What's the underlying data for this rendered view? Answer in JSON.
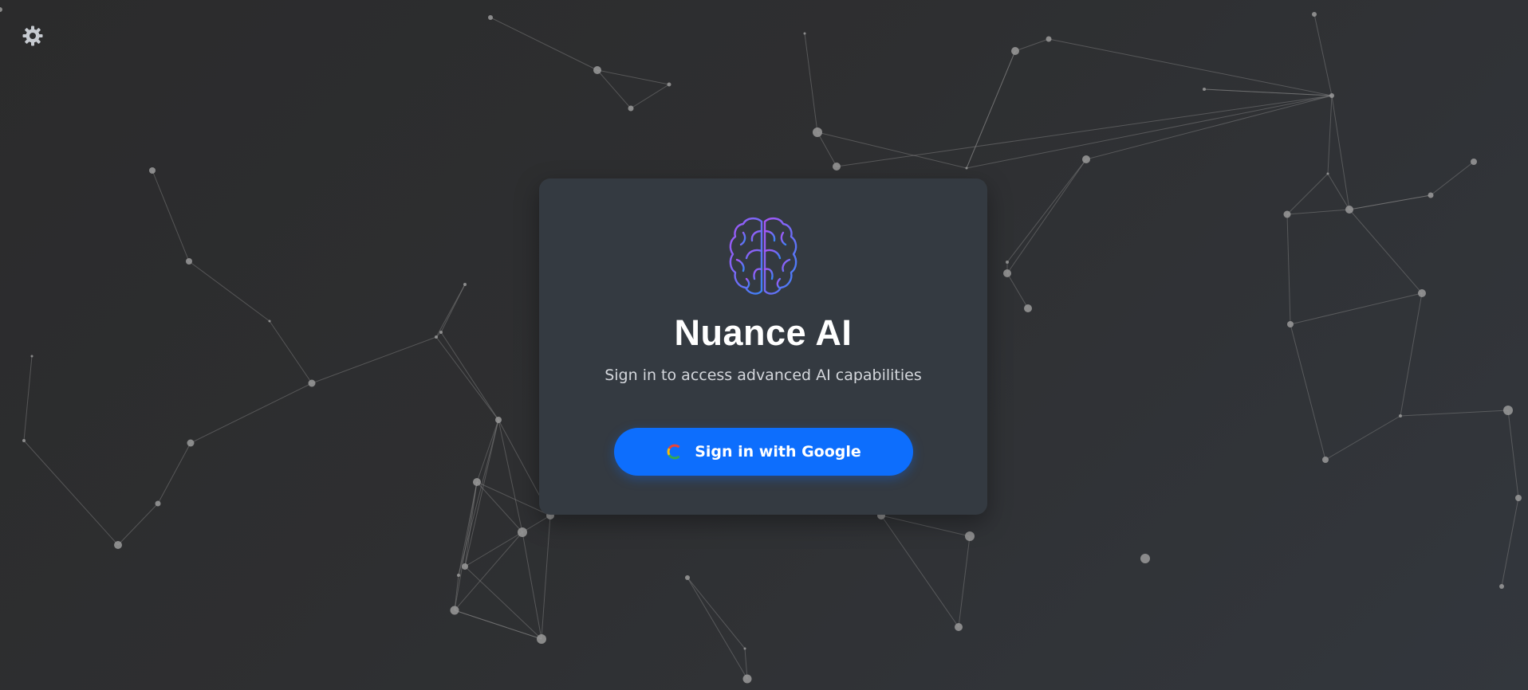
{
  "app": {
    "title": "Nuance AI",
    "subtitle": "Sign in to access advanced AI capabilities"
  },
  "auth": {
    "google_button_label": "Sign in with Google",
    "google_icon": "google-g-icon"
  },
  "toolbar": {
    "settings_icon": "gear-icon"
  },
  "logo": {
    "icon": "brain-icon",
    "gradient_colors": [
      "#a855f7",
      "#3b82f6"
    ]
  },
  "colors": {
    "background": "#2e2f31",
    "card": "#343a41",
    "accent": "#0d6efd",
    "network_node": "#9a9a9a"
  }
}
